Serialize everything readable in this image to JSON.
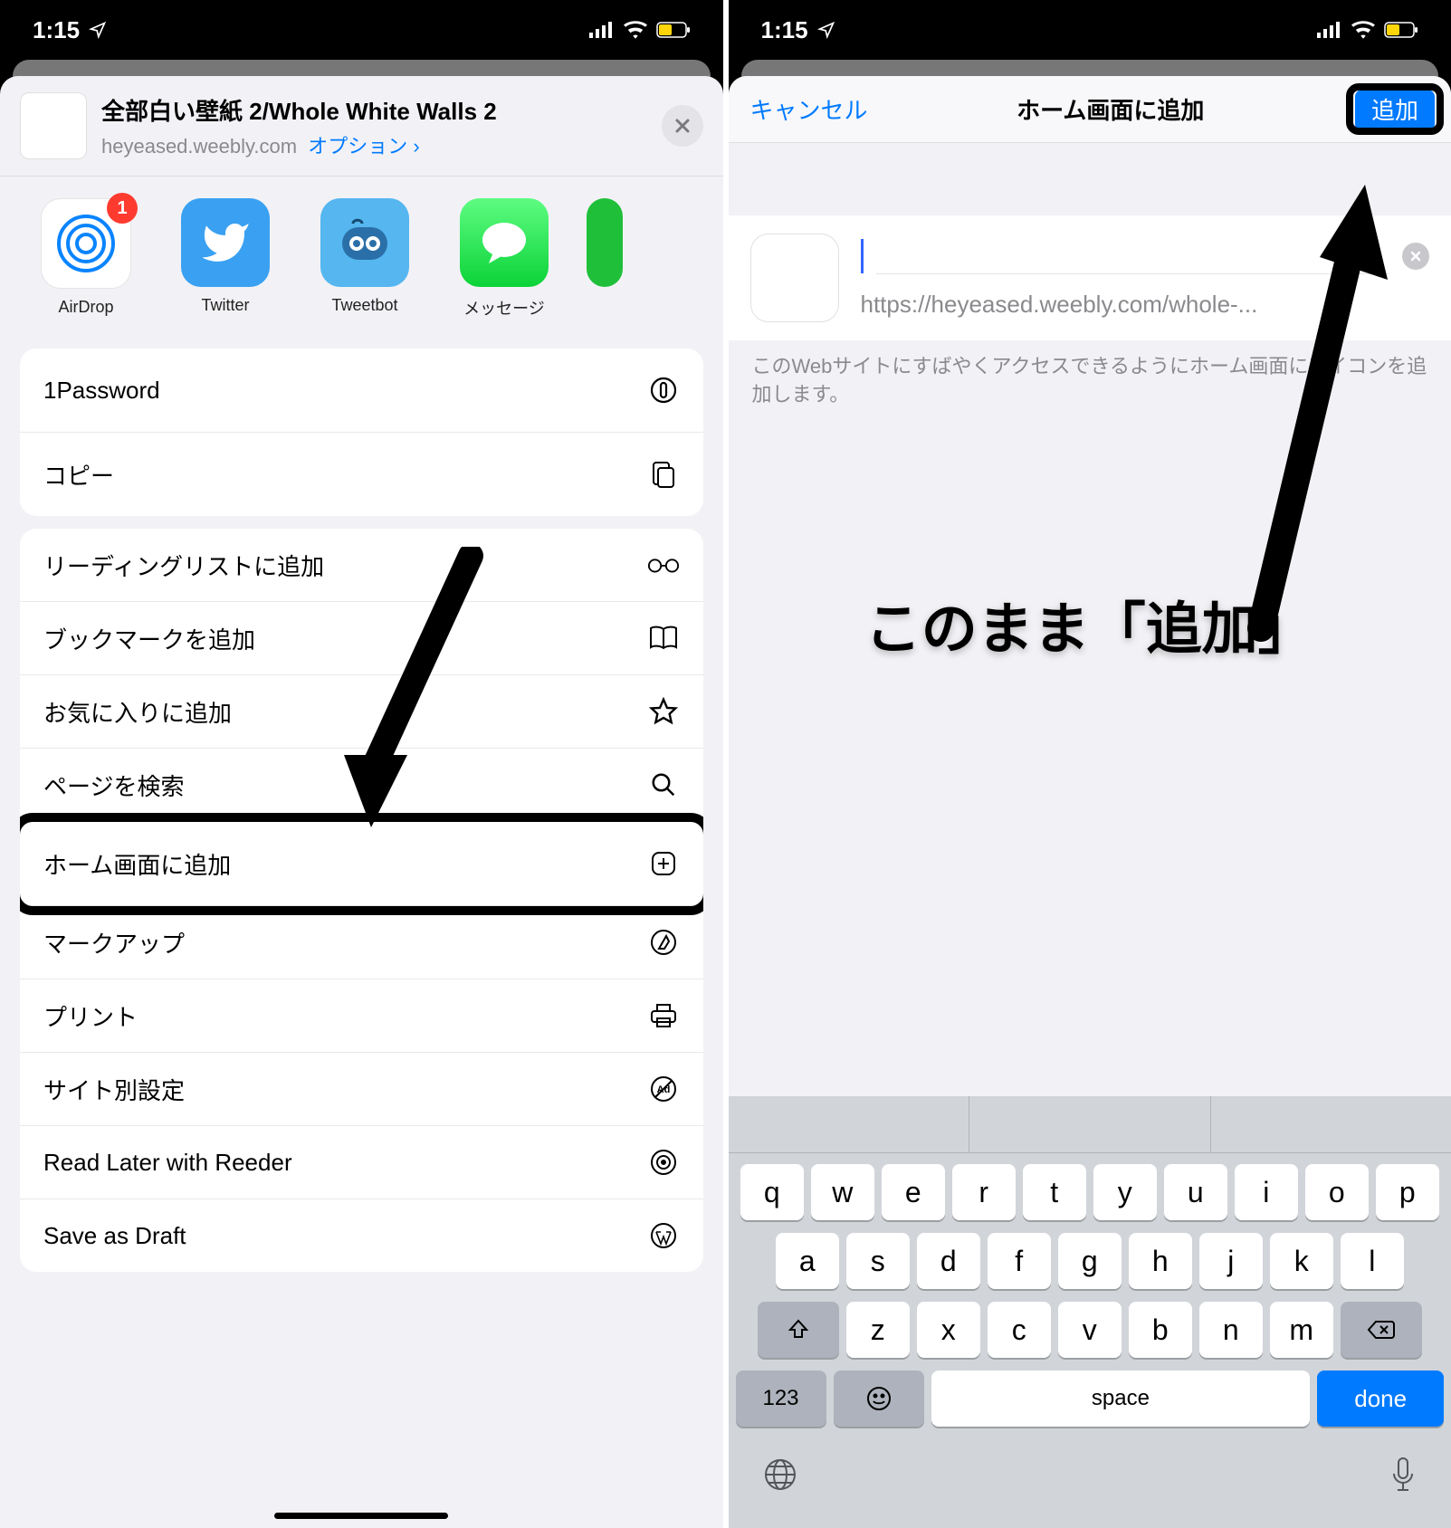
{
  "status": {
    "time": "1:15"
  },
  "left": {
    "share": {
      "title": "全部白い壁紙 2/Whole White Walls 2",
      "domain": "heyeased.weebly.com",
      "options_label": "オプション",
      "apps": {
        "airdrop": {
          "label": "AirDrop",
          "badge": "1"
        },
        "twitter": {
          "label": "Twitter"
        },
        "tweetbot": {
          "label": "Tweetbot"
        },
        "messages": {
          "label": "メッセージ"
        }
      }
    },
    "group1": {
      "onepassword": "1Password",
      "copy": "コピー"
    },
    "group2": {
      "reading_list": "リーディングリストに追加",
      "bookmark": "ブックマークを追加",
      "favorite": "お気に入りに追加",
      "find": "ページを検索",
      "home": "ホーム画面に追加",
      "markup": "マークアップ",
      "print": "プリント",
      "site_settings": "サイト別設定",
      "read_later": "Read Later with Reeder",
      "save_draft": "Save as Draft"
    }
  },
  "right": {
    "nav": {
      "cancel": "キャンセル",
      "title": "ホーム画面に追加",
      "add": "追加"
    },
    "url": "https://heyeased.weebly.com/whole-...",
    "desc": "このWebサイトにすばやくアクセスできるようにホーム画面にアイコンを追加します。",
    "annotation": "このまま「追加」",
    "keyboard": {
      "row1": [
        "q",
        "w",
        "e",
        "r",
        "t",
        "y",
        "u",
        "i",
        "o",
        "p"
      ],
      "row2": [
        "a",
        "s",
        "d",
        "f",
        "g",
        "h",
        "j",
        "k",
        "l"
      ],
      "row3": [
        "z",
        "x",
        "c",
        "v",
        "b",
        "n",
        "m"
      ],
      "fn": {
        "numbers": "123",
        "space": "space",
        "done": "done"
      }
    }
  }
}
